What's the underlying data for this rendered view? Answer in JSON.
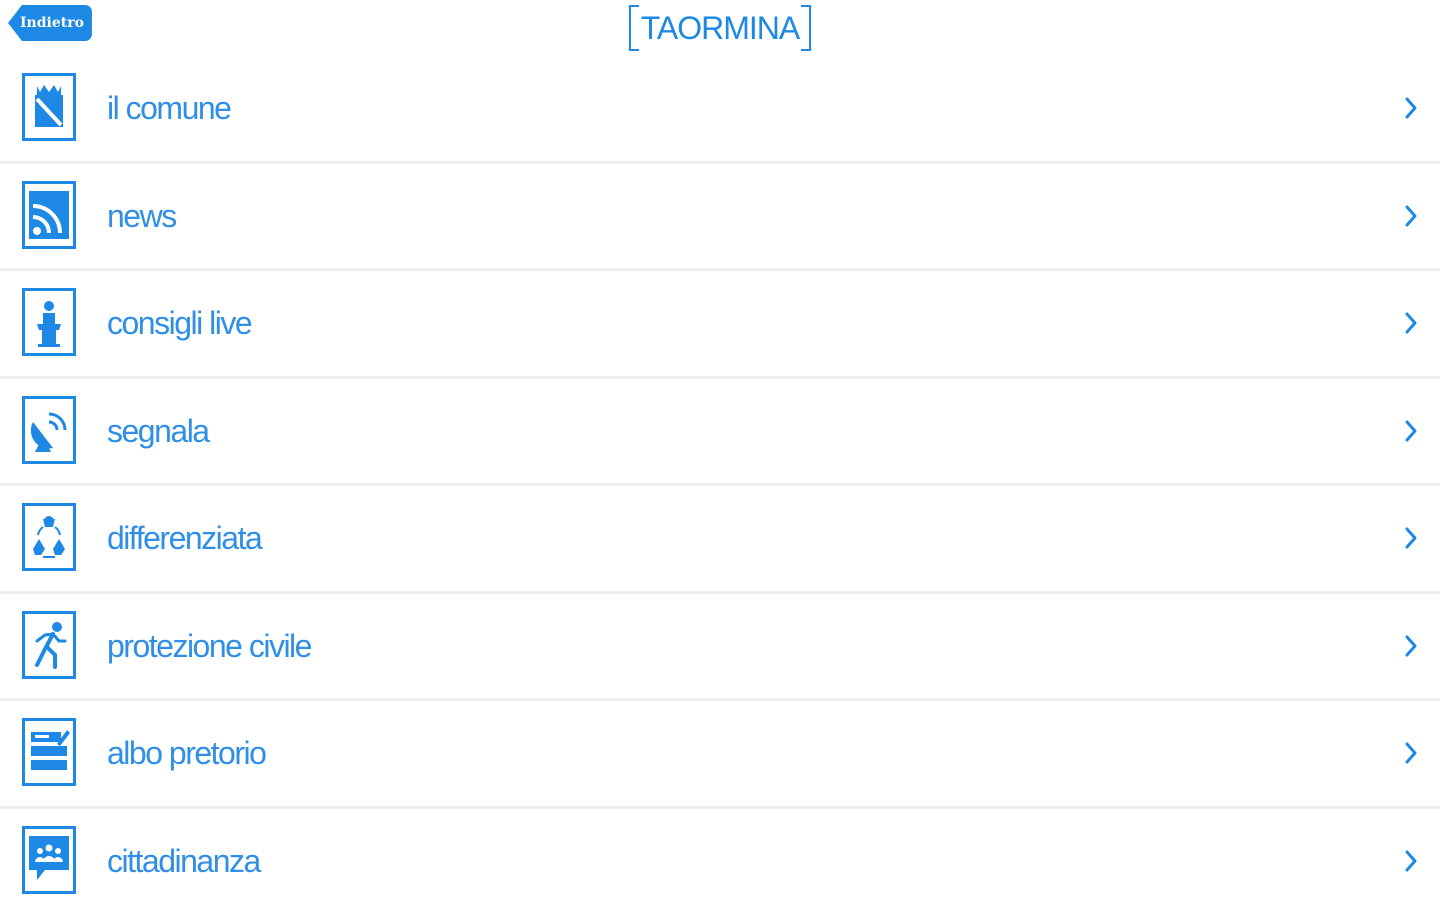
{
  "header": {
    "back_label": "Indietro",
    "title": "TAORMINA"
  },
  "colors": {
    "accent": "#1e88e5",
    "text": "#2f8fe8",
    "divider": "#eeeeee"
  },
  "menu": {
    "items": [
      {
        "label": "il comune",
        "icon": "town-hall-icon"
      },
      {
        "label": "news",
        "icon": "rss-icon"
      },
      {
        "label": "consigli live",
        "icon": "podium-icon"
      },
      {
        "label": "segnala",
        "icon": "satellite-dish-icon"
      },
      {
        "label": "differenziata",
        "icon": "recycle-icon"
      },
      {
        "label": "protezione civile",
        "icon": "running-person-icon"
      },
      {
        "label": "albo pretorio",
        "icon": "notice-board-icon"
      },
      {
        "label": "cittadinanza",
        "icon": "community-chat-icon"
      }
    ]
  }
}
